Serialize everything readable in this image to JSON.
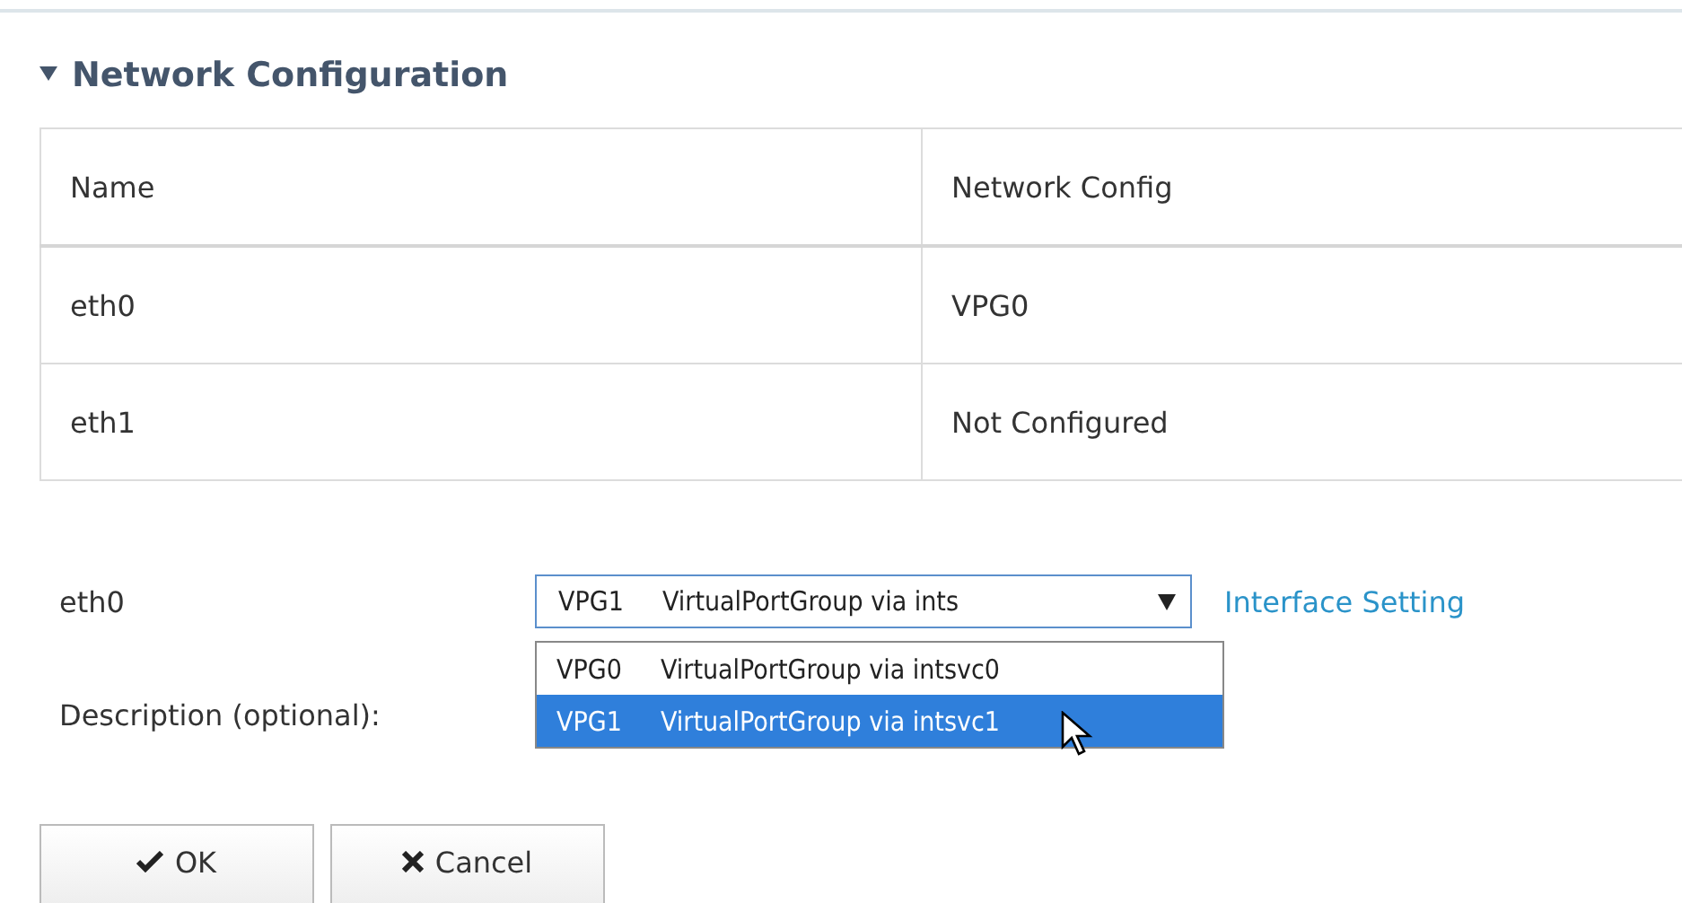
{
  "section": {
    "title": "Network Configuration",
    "expanded": true
  },
  "table": {
    "columns": [
      "Name",
      "Network Config"
    ],
    "rows": [
      [
        "eth0",
        "VPG0"
      ],
      [
        "eth1",
        "Not Configured"
      ]
    ]
  },
  "form": {
    "interface_label": "eth0",
    "select": {
      "code": "VPG1",
      "text": "VirtualPortGroup via ints",
      "expanded": true,
      "options": [
        {
          "code": "VPG0",
          "text": "VirtualPortGroup via intsvc0",
          "selected": false
        },
        {
          "code": "VPG1",
          "text": "VirtualPortGroup via intsvc1",
          "selected": true
        }
      ]
    },
    "link": "Interface Setting",
    "description_label": "Description (optional):"
  },
  "buttons": [
    {
      "kind": "ok",
      "label": "OK"
    },
    {
      "kind": "cancel",
      "label": "Cancel"
    }
  ]
}
